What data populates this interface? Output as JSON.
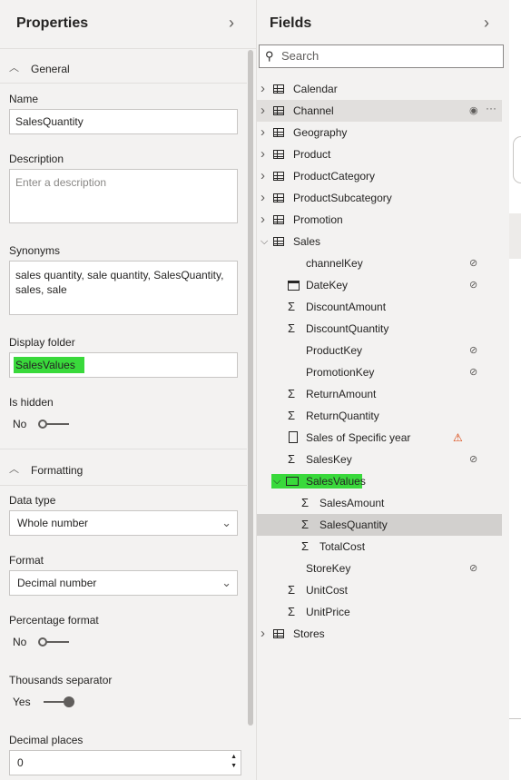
{
  "properties": {
    "title": "Properties",
    "general_label": "General",
    "name_label": "Name",
    "name_value": "SalesQuantity",
    "description_label": "Description",
    "description_placeholder": "Enter a description",
    "synonyms_label": "Synonyms",
    "synonyms_value": "sales quantity, sale quantity, SalesQuantity, sales, sale",
    "display_folder_label": "Display folder",
    "display_folder_value": "SalesValues",
    "is_hidden_label": "Is hidden",
    "is_hidden_value": "No",
    "formatting_label": "Formatting",
    "data_type_label": "Data type",
    "data_type_value": "Whole number",
    "format_label": "Format",
    "format_value": "Decimal number",
    "percentage_label": "Percentage format",
    "percentage_value": "No",
    "thousands_label": "Thousands separator",
    "thousands_value": "Yes",
    "decimal_label": "Decimal places",
    "decimal_value": "0"
  },
  "fields": {
    "title": "Fields",
    "search_placeholder": "Search",
    "tables_top": [
      "Calendar",
      "Channel",
      "Geography",
      "Product",
      "ProductCategory",
      "ProductSubcategory",
      "Promotion"
    ],
    "sales_table": "Sales",
    "sales_fields": [
      {
        "label": "channelKey",
        "icon": "none",
        "hidden": true
      },
      {
        "label": "DateKey",
        "icon": "calendar-icon",
        "hidden": true
      },
      {
        "label": "DiscountAmount",
        "icon": "sigma-icon",
        "hidden": false
      },
      {
        "label": "DiscountQuantity",
        "icon": "sigma-icon",
        "hidden": false
      },
      {
        "label": "ProductKey",
        "icon": "none",
        "hidden": true
      },
      {
        "label": "PromotionKey",
        "icon": "none",
        "hidden": true
      },
      {
        "label": "ReturnAmount",
        "icon": "sigma-icon",
        "hidden": false
      },
      {
        "label": "ReturnQuantity",
        "icon": "sigma-icon",
        "hidden": false
      },
      {
        "label": "Sales of Specific year",
        "icon": "calculator-icon",
        "hidden": false,
        "warning": true
      },
      {
        "label": "SalesKey",
        "icon": "sigma-icon",
        "hidden": true
      }
    ],
    "folder": "SalesValues",
    "folder_fields": [
      "SalesAmount",
      "SalesQuantity",
      "TotalCost"
    ],
    "after_fields": [
      {
        "label": "StoreKey",
        "icon": "none",
        "hidden": true
      },
      {
        "label": "UnitCost",
        "icon": "sigma-icon",
        "hidden": false
      },
      {
        "label": "UnitPrice",
        "icon": "sigma-icon",
        "hidden": false
      }
    ],
    "tables_bottom": [
      "Stores"
    ]
  },
  "colors": {
    "highlight": "#39d93b",
    "selected_row": "#d2d0ce",
    "warning": "#d83b01"
  }
}
